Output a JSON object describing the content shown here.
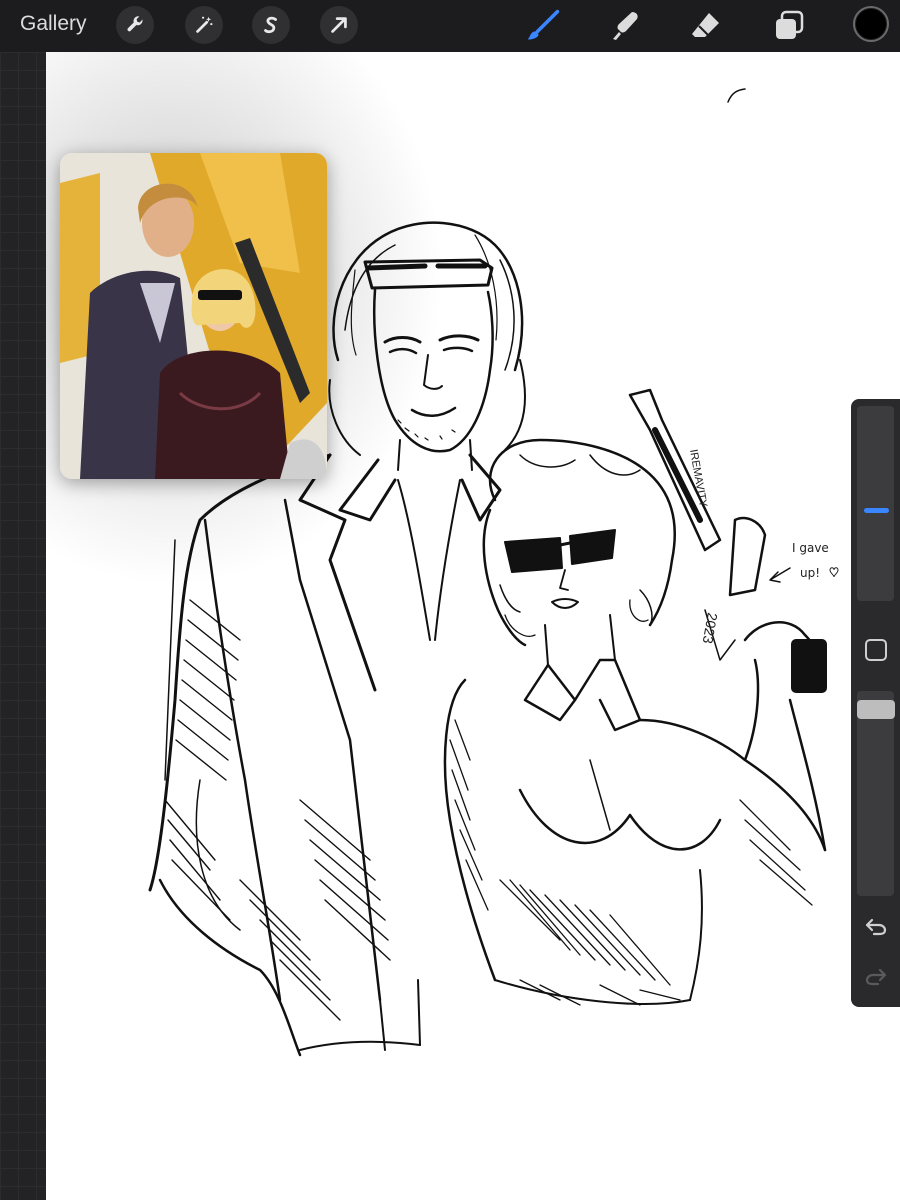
{
  "toolbar": {
    "gallery_label": "Gallery",
    "left_tools": [
      "wrench-icon",
      "magic-wand-icon",
      "selection-s-icon",
      "transform-arrow-icon"
    ],
    "right_tools": [
      "brush-icon",
      "smudge-icon",
      "eraser-icon",
      "layers-icon"
    ],
    "active_tool": "brush",
    "active_color": "#000000",
    "accent_color": "#3a86ff"
  },
  "reference": {
    "name": "reference-image"
  },
  "sidebar": {
    "brush_size": "upper third",
    "brush_opacity": "full",
    "modify_icon": "square-icon",
    "undo_icon": "undo-icon",
    "redo_icon": "redo-icon"
  },
  "canvas": {
    "annotations": {
      "watermark": "IREMAVITY",
      "signature": "2023",
      "note_line1": "I gave",
      "note_line2": "up!"
    }
  }
}
